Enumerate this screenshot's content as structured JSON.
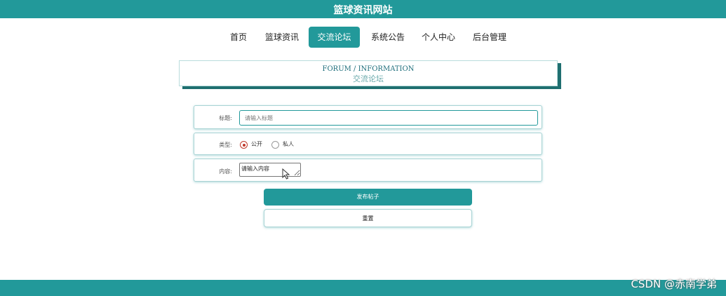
{
  "site": {
    "title": "篮球资讯网站"
  },
  "nav": {
    "items": [
      {
        "label": "首页"
      },
      {
        "label": "篮球资讯"
      },
      {
        "label": "交流论坛",
        "active": true
      },
      {
        "label": "系统公告"
      },
      {
        "label": "个人中心"
      },
      {
        "label": "后台管理"
      }
    ]
  },
  "banner": {
    "en": "FORUM / INFORMATION",
    "cn": "交流论坛"
  },
  "form": {
    "title_label": "标题:",
    "title_placeholder": "请输入标题",
    "type_label": "类型:",
    "type_options": [
      {
        "label": "公开",
        "checked": true
      },
      {
        "label": "私人",
        "checked": false
      }
    ],
    "content_label": "内容:",
    "content_value": "请输入内容"
  },
  "buttons": {
    "submit": "发布帖子",
    "reset": "重置"
  },
  "watermark": "CSDN @赤南学弟",
  "colors": {
    "primary": "#22999a",
    "radio_checked": "#c0392b"
  }
}
